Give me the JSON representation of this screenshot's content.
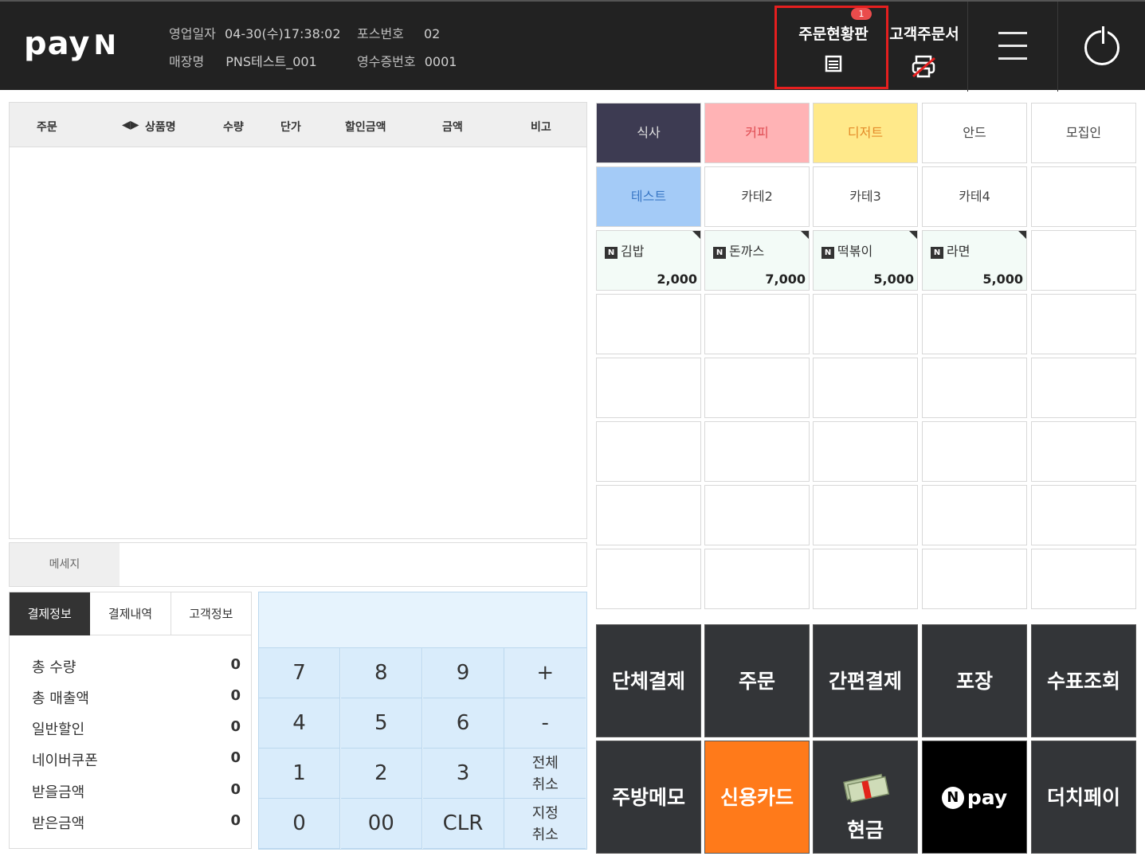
{
  "header": {
    "logo_text": "pay",
    "logo_n": "N",
    "business_date_label": "영업일자",
    "business_date": "04-30(수)17:38:02",
    "pos_no_label": "포스번호",
    "pos_no": "02",
    "store_label": "매장명",
    "store_name": "PNS테스트_001",
    "receipt_no_label": "영수증번호",
    "receipt_no": "0001",
    "order_board_label": "주문현황판",
    "order_board_badge": "1",
    "customer_order_label": "고객주문서",
    "order_board_icon": "clipboard-icon",
    "customer_order_icon": "printer-off-icon",
    "menu_icon": "hamburger-menu-icon",
    "power_icon": "power-icon",
    "highlight_color": "#e51f1f"
  },
  "order_table": {
    "columns": [
      "주문",
      "상품명",
      "수량",
      "단가",
      "할인금액",
      "금액",
      "비고"
    ],
    "sort_arrow": "◀▶"
  },
  "message": {
    "label": "메세지",
    "value": ""
  },
  "pay_tabs": [
    "결제정보",
    "결제내역",
    "고객정보"
  ],
  "summary": [
    {
      "label": "총 수량",
      "value": "0"
    },
    {
      "label": "총 매출액",
      "value": "0"
    },
    {
      "label": "일반할인",
      "value": "0"
    },
    {
      "label": "네이버쿠폰",
      "value": "0"
    },
    {
      "label": "받을금액",
      "value": "0"
    },
    {
      "label": "받은금액",
      "value": "0"
    }
  ],
  "keypad": {
    "display": "",
    "keys": [
      "7",
      "8",
      "9",
      "+",
      "4",
      "5",
      "6",
      "-",
      "1",
      "2",
      "3",
      "전체\n취소",
      "0",
      "00",
      "CLR",
      "지정\n취소"
    ]
  },
  "categories": [
    {
      "label": "식사",
      "bg": "#3d3b52",
      "fg": "#e0e0e0"
    },
    {
      "label": "커피",
      "bg": "#ffb3b5",
      "fg": "#e04e54"
    },
    {
      "label": "디저트",
      "bg": "#ffe98a",
      "fg": "#e48b29"
    },
    {
      "label": "안드",
      "bg": "#ffffff",
      "fg": "#444444"
    },
    {
      "label": "모집인",
      "bg": "#ffffff",
      "fg": "#444444"
    },
    {
      "label": "테스트",
      "bg": "#a4cbf7",
      "fg": "#3a78c6"
    },
    {
      "label": "카테2",
      "bg": "#ffffff",
      "fg": "#444444"
    },
    {
      "label": "카테3",
      "bg": "#ffffff",
      "fg": "#444444"
    },
    {
      "label": "카테4",
      "bg": "#ffffff",
      "fg": "#444444"
    },
    {
      "label": "",
      "bg": "#ffffff",
      "fg": "#444444"
    }
  ],
  "products": [
    {
      "badge": "N",
      "name": "김밥",
      "price": "2,000"
    },
    {
      "badge": "N",
      "name": "돈까스",
      "price": "7,000"
    },
    {
      "badge": "N",
      "name": "떡볶이",
      "price": "5,000"
    },
    {
      "badge": "N",
      "name": "라면",
      "price": "5,000"
    }
  ],
  "actions": [
    {
      "label": "단체결제",
      "style": "dark"
    },
    {
      "label": "주문",
      "style": "dark"
    },
    {
      "label": "간편결제",
      "style": "dark"
    },
    {
      "label": "포장",
      "style": "dark"
    },
    {
      "label": "수표조회",
      "style": "dark"
    },
    {
      "label": "주방메모",
      "style": "dark"
    },
    {
      "label": "신용카드",
      "style": "orange"
    },
    {
      "label": "현금",
      "style": "cash",
      "icon": "cash-bundle-icon"
    },
    {
      "label": "pay",
      "style": "black",
      "prefix": "N"
    },
    {
      "label": "더치페이",
      "style": "dark"
    }
  ]
}
